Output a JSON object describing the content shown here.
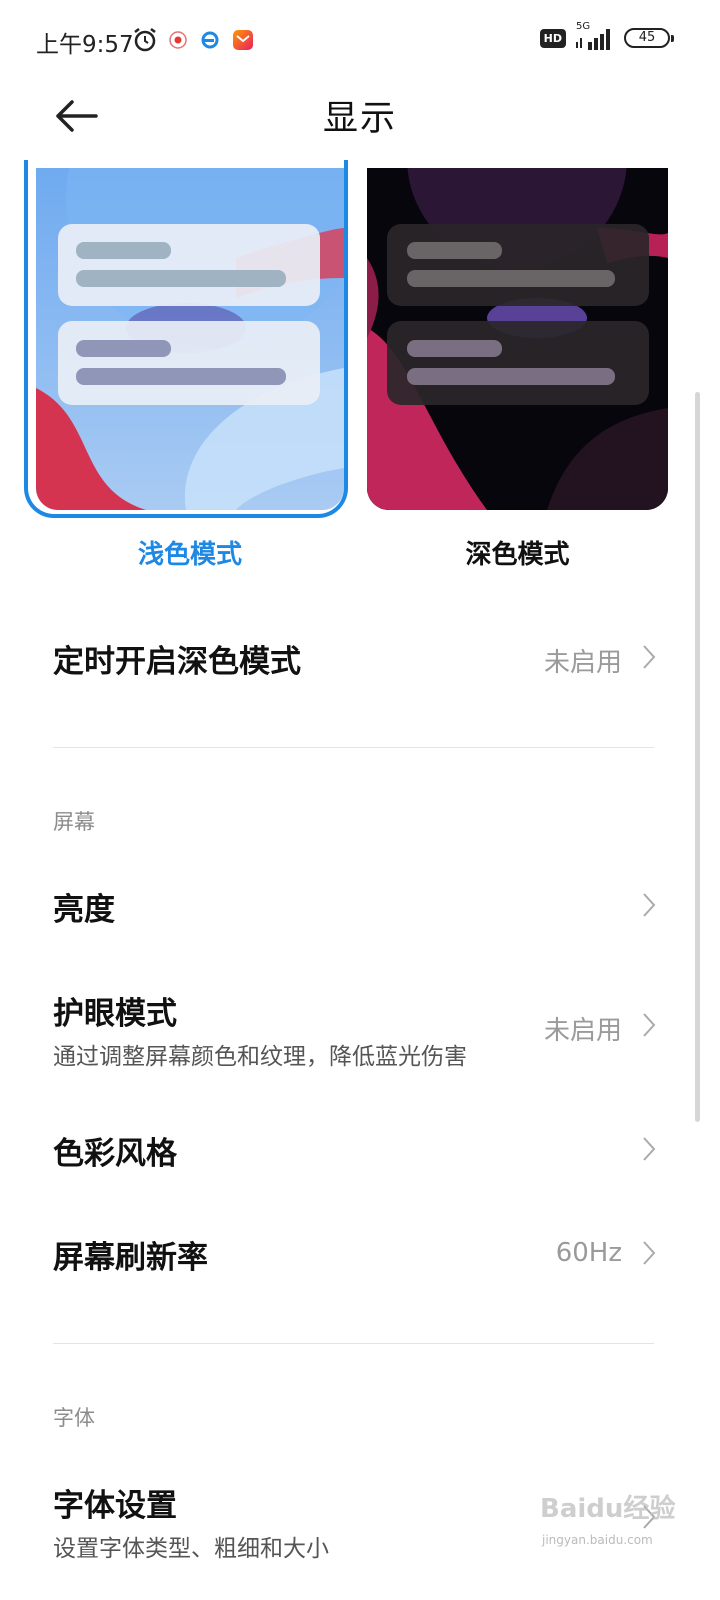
{
  "status_bar": {
    "time": "上午9:57",
    "hd_badge": "HD",
    "network": "5G",
    "battery": "45"
  },
  "header": {
    "title": "显示",
    "back_icon": "arrow-left-icon"
  },
  "appearance": {
    "light_mode_label": "浅色模式",
    "dark_mode_label": "深色模式",
    "selected": "light",
    "accent_color": "#1e88e5"
  },
  "schedule_dark": {
    "title": "定时开启深色模式",
    "value": "未启用"
  },
  "screen_section": {
    "header": "屏幕",
    "items": [
      {
        "title": "亮度",
        "subtitle": "",
        "value": ""
      },
      {
        "title": "护眼模式",
        "subtitle": "通过调整屏幕颜色和纹理，降低蓝光伤害",
        "value": "未启用"
      },
      {
        "title": "色彩风格",
        "subtitle": "",
        "value": ""
      },
      {
        "title": "屏幕刷新率",
        "subtitle": "",
        "value": "60Hz"
      }
    ]
  },
  "font_section": {
    "header": "字体",
    "items": [
      {
        "title": "字体设置",
        "subtitle": "设置字体类型、粗细和大小"
      }
    ]
  },
  "watermark": {
    "text": "Baidu经验",
    "sub": "jingyan.baidu.com"
  }
}
